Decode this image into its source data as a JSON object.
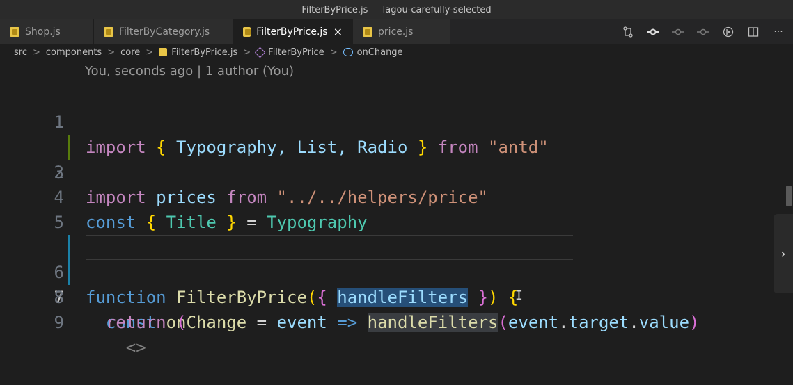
{
  "window": {
    "title": "FilterByPrice.js — lagou-carefully-selected"
  },
  "tabs": [
    {
      "label": "Shop.js",
      "active": false
    },
    {
      "label": "FilterByCategory.js",
      "active": false
    },
    {
      "label": "FilterByPrice.js",
      "active": true,
      "close": "×"
    },
    {
      "label": "price.js",
      "active": false
    }
  ],
  "toolbar": {
    "icons": [
      "git-compare-icon",
      "git-commit-icon",
      "git-commit-prev-icon",
      "git-commit-next-icon",
      "open-changes-icon",
      "split-editor-icon",
      "more-actions-icon"
    ],
    "more": "···"
  },
  "breadcrumbs": {
    "items": [
      "src",
      "components",
      "core",
      "FilterByPrice.js",
      "FilterByPrice",
      "onChange"
    ],
    "separator": ">"
  },
  "blame": {
    "text": "You, seconds ago | 1 author (You)"
  },
  "editor": {
    "lines": [
      {
        "n": "1",
        "t": [
          "import",
          " ",
          "{",
          " Typography, List, Radio ",
          "}",
          " from ",
          "\"antd\""
        ]
      },
      {
        "n": "2",
        "t": [
          "import",
          " prices ",
          "from",
          " ",
          "\"../../helpers/price\""
        ]
      },
      {
        "n": "3",
        "t": []
      },
      {
        "n": "4",
        "t": [
          "const",
          " ",
          "{",
          " ",
          "Title",
          " ",
          "}",
          " = ",
          "Typography"
        ]
      },
      {
        "n": "5",
        "t": []
      },
      {
        "n": "6",
        "t": [
          "function",
          " ",
          "FilterByPrice",
          "(",
          "{",
          " ",
          "handleFilters",
          " ",
          "}",
          ")",
          " ",
          "{"
        ]
      },
      {
        "n": "7",
        "t": [
          "  ",
          "const",
          " ",
          "onChange",
          " = ",
          "event",
          " ",
          "=>",
          " ",
          "handleFilters",
          "(",
          "event",
          ".",
          "target",
          ".",
          "value",
          ")"
        ]
      },
      {
        "n": "8",
        "t": [
          "  ",
          "return",
          " ",
          "("
        ]
      },
      {
        "n": "9",
        "t": [
          "    ",
          "<>"
        ]
      }
    ]
  },
  "colors": {
    "keyword": "#569cd6",
    "control": "#c586c0",
    "bracket": "#ffd700",
    "string": "#ce9178",
    "identifier": "#9cdcfe",
    "type": "#4ec9b0",
    "function": "#dcdcaa",
    "git_added": "#587c0c",
    "git_modified": "#1b81a8"
  },
  "scroll": {
    "arrow": "›"
  },
  "cursor": {
    "glyph": "I"
  }
}
